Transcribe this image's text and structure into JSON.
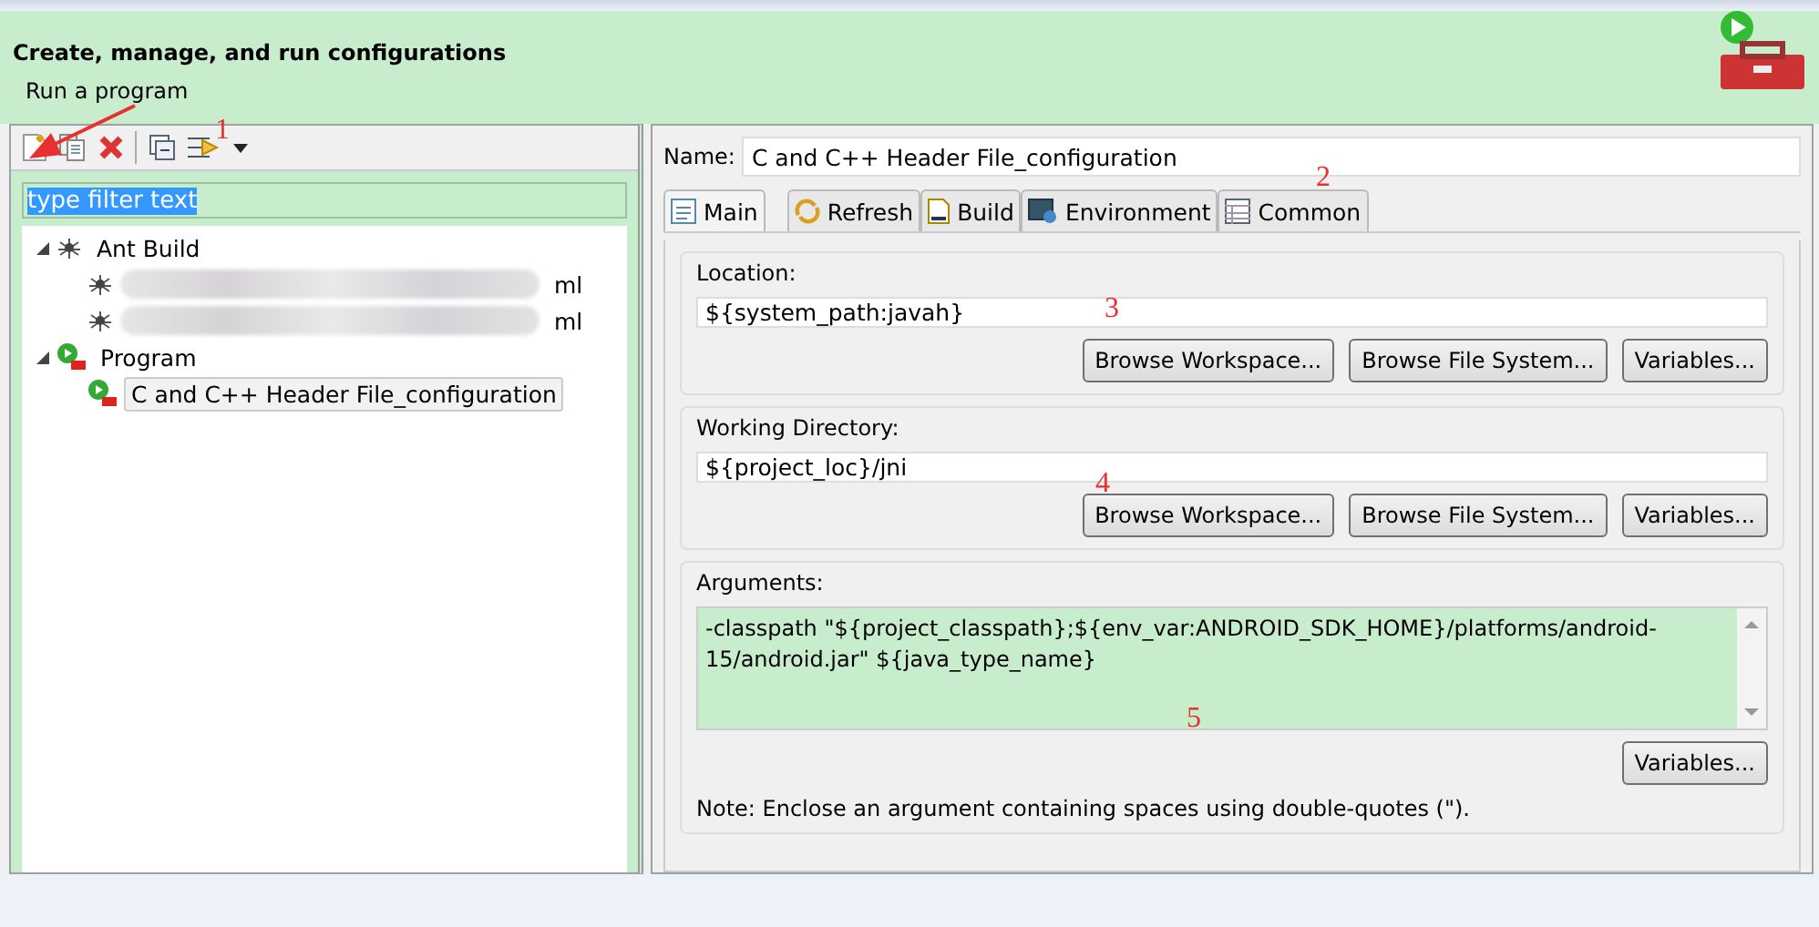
{
  "header": {
    "title": "Create, manage, and run configurations",
    "subtitle": "Run a program"
  },
  "toolbar": [
    {
      "kind": "new"
    },
    {
      "kind": "duplicate"
    },
    {
      "kind": "delete"
    },
    {
      "kind": "separator"
    },
    {
      "kind": "collapse"
    },
    {
      "kind": "filter"
    },
    {
      "kind": "dropdown"
    }
  ],
  "filter": {
    "value": "type filter text",
    "selected": true
  },
  "tree": [
    {
      "label": "Ant Build",
      "kind": "ant",
      "expanded": true,
      "children": [
        {
          "label": "ml",
          "kind": "ant-item",
          "blurred": true,
          "selected": false
        },
        {
          "label": "ml",
          "kind": "ant-item",
          "blurred": true,
          "selected": false
        }
      ]
    },
    {
      "label": "Program",
      "kind": "program",
      "expanded": true,
      "children": [
        {
          "label": "C and C++ Header File_configuration",
          "kind": "program-item",
          "blurred": false,
          "selected": true
        }
      ]
    }
  ],
  "name": {
    "label": "Name:",
    "value": "C and C++ Header File_configuration"
  },
  "tabs": [
    {
      "label": "Main",
      "kind": "main",
      "selected": true
    },
    {
      "label": "Refresh",
      "kind": "refresh",
      "selected": false
    },
    {
      "label": "Build",
      "kind": "build",
      "selected": false
    },
    {
      "label": "Environment",
      "kind": "environment",
      "selected": false
    },
    {
      "label": "Common",
      "kind": "common",
      "selected": false
    }
  ],
  "groups": [
    {
      "label": "Location:",
      "value": "${system_path:javah}",
      "buttons": [
        "Browse Workspace...",
        "Browse File System...",
        "Variables..."
      ]
    },
    {
      "label": "Working Directory:",
      "value": "${project_loc}/jni",
      "buttons": [
        "Browse Workspace...",
        "Browse File System...",
        "Variables..."
      ]
    }
  ],
  "arguments": {
    "label": "Arguments:",
    "value": "-classpath \"${project_classpath};${env_var:ANDROID_SDK_HOME}/platforms/android-15/android.jar\" ${java_type_name}",
    "button": "Variables...",
    "note": "Note: Enclose an argument containing spaces using double-quotes (\")."
  },
  "annotations": [
    "1",
    "2",
    "3",
    "4",
    "5"
  ]
}
